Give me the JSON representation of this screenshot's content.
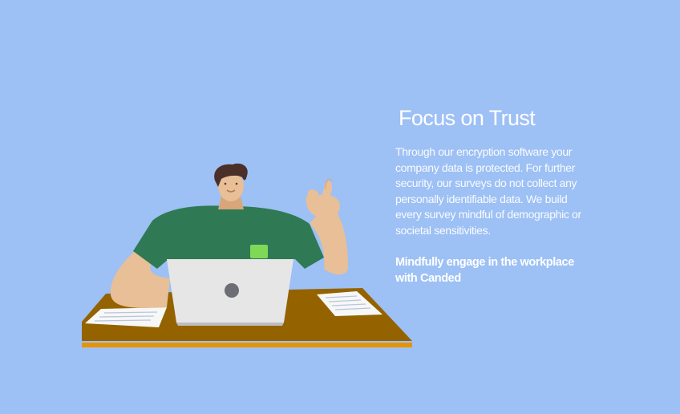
{
  "section": {
    "title": "Focus on Trust",
    "body": "Through our encryption software your company data is protected. For further security, our surveys do not collect any personally identifiable data. We build every survey mindful of demographic or societal sensitivities.",
    "tagline": "Mindfully engage in the workplace with Canded"
  },
  "illustration": {
    "subject": "person-at-laptop-thumbs-up",
    "colors": {
      "background": "#9dc0f5",
      "desk_top": "#946300",
      "desk_edge": "#e69400",
      "shirt": "#2f7a55",
      "skin": "#e8bf96",
      "hair": "#4a3029",
      "laptop": "#e8e8e8",
      "pocket": "#7ed957"
    }
  }
}
